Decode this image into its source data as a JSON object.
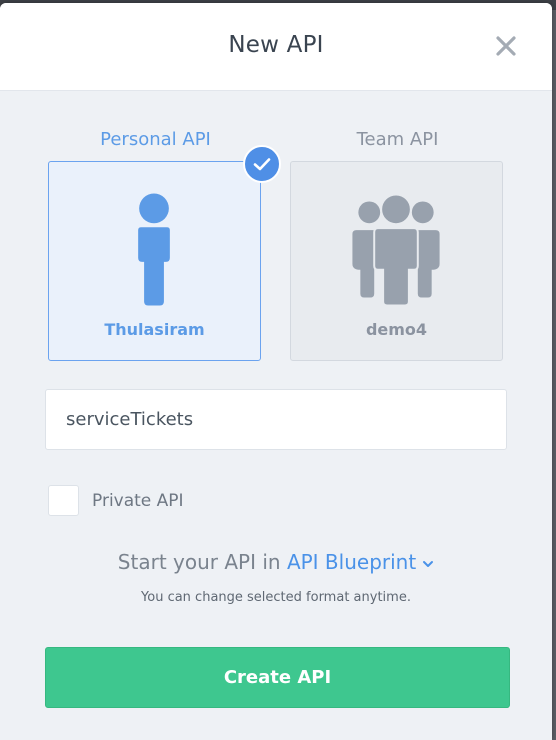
{
  "modal": {
    "title": "New API",
    "close_icon": "close-icon"
  },
  "api_types": [
    {
      "label": "Personal API",
      "owner": "Thulasiram",
      "icon": "person-icon",
      "selected": true
    },
    {
      "label": "Team API",
      "owner": "demo4",
      "icon": "team-icon",
      "selected": false
    }
  ],
  "name_input": {
    "value": "serviceTickets"
  },
  "private_api": {
    "label": "Private API",
    "checked": false
  },
  "format": {
    "prefix": "Start your API in",
    "selected": "API Blueprint",
    "note": "You can change selected format anytime."
  },
  "create_button": {
    "label": "Create API"
  },
  "colors": {
    "accent_blue": "#5c9be6",
    "muted_gray": "#8b93a0",
    "create_green": "#3ec78f",
    "check_blue": "#4f8fe6"
  }
}
